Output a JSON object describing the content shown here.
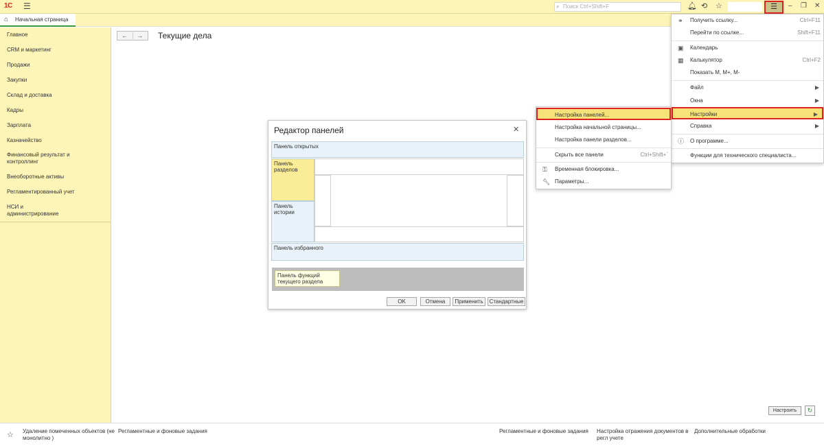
{
  "topbar": {
    "logo": "1С",
    "search_placeholder": "Поиск Ctrl+Shift+F"
  },
  "tabs": {
    "home": "Начальная страница"
  },
  "sidebar": {
    "items": [
      "Главное",
      "CRM и маркетинг",
      "Продажи",
      "Закупки",
      "Склад и доставка",
      "Кадры",
      "Зарплата",
      "Казначейство",
      "Финансовый результат и контроллинг",
      "Внеоборотные активы",
      "Регламентированный учет",
      "НСИ и администрирование"
    ]
  },
  "main": {
    "title": "Текущие дела"
  },
  "dialog": {
    "title": "Редактор панелей",
    "panel_open": "Панель открытых",
    "panel_sections": "Панель разделов",
    "panel_history": "Панель истории",
    "panel_favorites": "Панель избранного",
    "panel_functions": "Панель функций текущего раздела",
    "buttons": {
      "ok": "OK",
      "cancel": "Отмена",
      "apply": "Применить",
      "default": "Стандартные"
    }
  },
  "main_menu": {
    "items": [
      {
        "label": "Получить ссылку...",
        "shortcut": "Ctrl+F11",
        "icon": "link-icon"
      },
      {
        "label": "Перейти по ссылке...",
        "shortcut": "Shift+F11",
        "icon": ""
      },
      {
        "label": "Календарь",
        "shortcut": "",
        "icon": "calendar-icon"
      },
      {
        "label": "Калькулятор",
        "shortcut": "Ctrl+F2",
        "icon": "calculator-icon"
      },
      {
        "label": "Показать M, M+, M-",
        "shortcut": "",
        "icon": ""
      },
      {
        "label": "Файл",
        "shortcut": "",
        "icon": ""
      },
      {
        "label": "Окна",
        "shortcut": "",
        "icon": ""
      },
      {
        "label": "Настройки",
        "shortcut": "",
        "icon": ""
      },
      {
        "label": "Справка",
        "shortcut": "",
        "icon": ""
      },
      {
        "label": "О программе...",
        "shortcut": "",
        "icon": "info-icon"
      },
      {
        "label": "Функции для технического специалиста...",
        "shortcut": "",
        "icon": ""
      }
    ]
  },
  "sub_menu": {
    "items": [
      {
        "label": "Настройка панелей...",
        "shortcut": ""
      },
      {
        "label": "Настройка начальной страницы...",
        "shortcut": ""
      },
      {
        "label": "Настройка панели разделов...",
        "shortcut": ""
      },
      {
        "label": "Скрыть все панели",
        "shortcut": "Ctrl+Shift+`"
      },
      {
        "label": "Временная блокировка...",
        "shortcut": ""
      },
      {
        "label": "Параметры...",
        "shortcut": ""
      }
    ]
  },
  "footer": {
    "button_customize": "Настроить",
    "links": [
      "Удаление помеченных объектов (не монолитно )",
      "Регламентные и фоновые задания",
      "Регламентные и фоновые задания",
      "Настройка отражения документов в регл учете",
      "Дополнительные обработки"
    ]
  },
  "colors": {
    "accent_yellow": "#fdf5b8",
    "highlight_red": "#dd2222",
    "active_tab": "#3a9a3a"
  }
}
